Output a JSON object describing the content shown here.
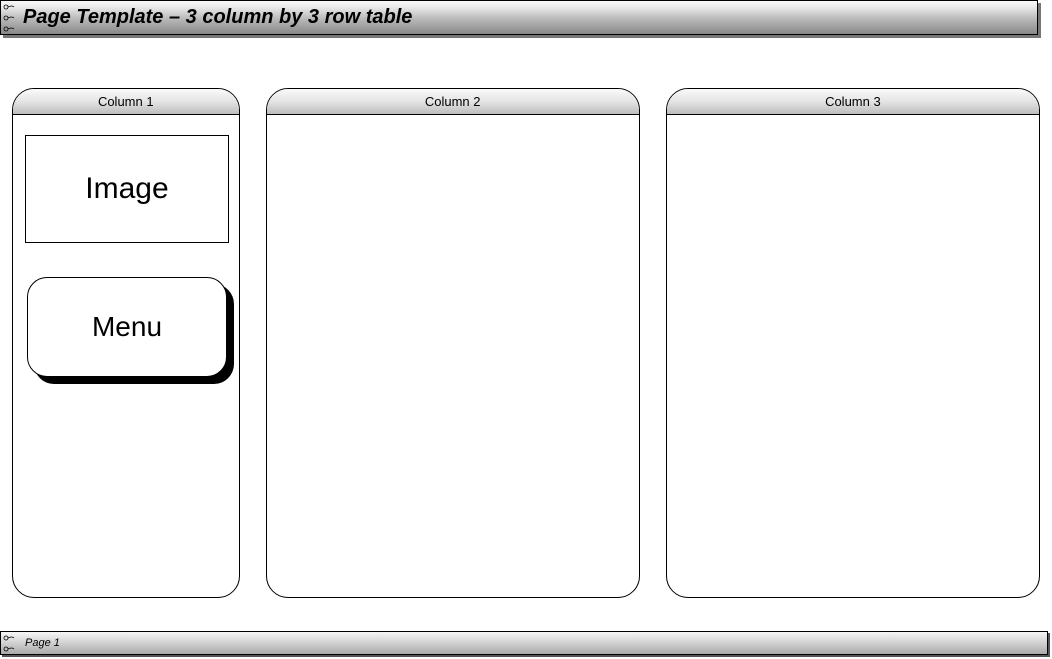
{
  "title": "Page Template – 3 column by 3 row table",
  "columns": [
    {
      "header": "Column 1"
    },
    {
      "header": "Column 2"
    },
    {
      "header": "Column 3"
    }
  ],
  "image_placeholder": "Image",
  "menu_placeholder": "Menu",
  "footer": "Page 1"
}
